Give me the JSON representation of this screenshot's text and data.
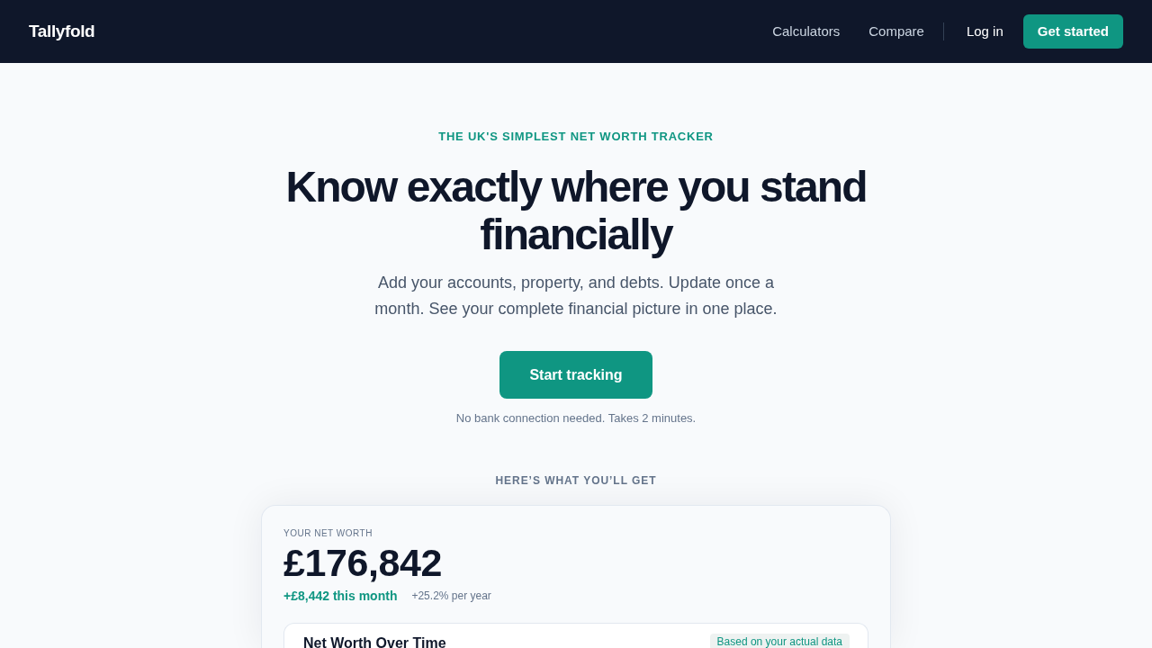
{
  "nav": {
    "logo": "Tallyfold",
    "links": [
      {
        "label": "Calculators"
      },
      {
        "label": "Compare"
      }
    ],
    "login": "Log in",
    "cta": "Get started"
  },
  "hero": {
    "eyebrow": "THE UK'S SIMPLEST NET WORTH TRACKER",
    "title": "Know exactly where you stand financially",
    "subtitle": "Add your accounts, property, and debts. Update once a month. See your complete financial picture in one place.",
    "cta": "Start tracking",
    "note": "No bank connection needed. Takes 2 minutes."
  },
  "preview": {
    "heading": "HERE’S WHAT YOU’LL GET",
    "card": {
      "label": "YOUR NET WORTH",
      "value": "£176,842",
      "change": "+£8,442 this month",
      "growth": "+25.2% per year",
      "chart_panel": {
        "title": "Net Worth Over Time",
        "badge": "Based on your actual data"
      }
    }
  }
}
